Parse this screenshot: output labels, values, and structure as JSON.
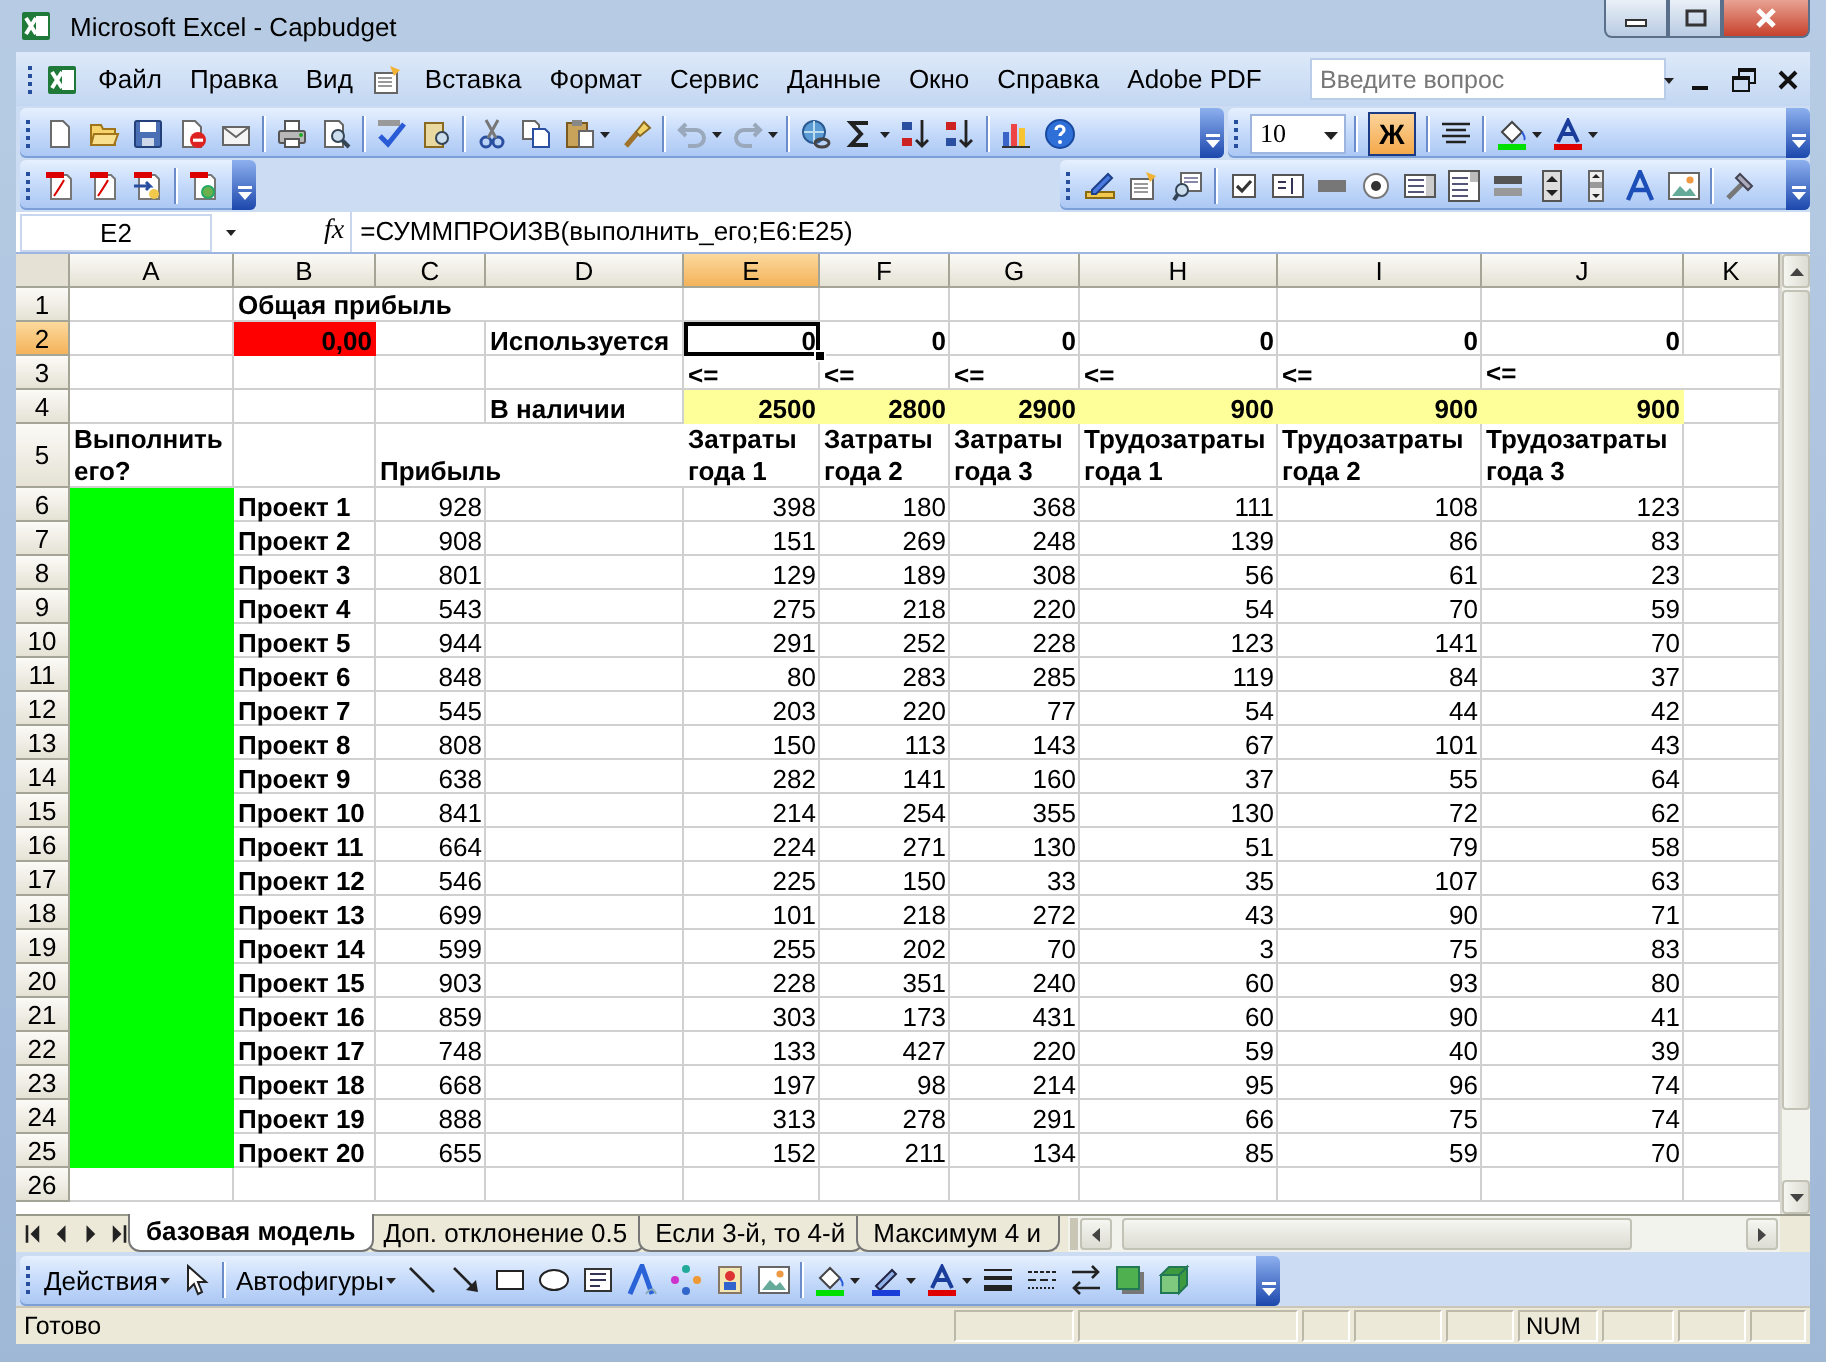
{
  "window": {
    "title": "Microsoft Excel - Capbudget"
  },
  "menu": [
    "Файл",
    "Правка",
    "Вид",
    "Вставка",
    "Формат",
    "Сервис",
    "Данные",
    "Окно",
    "Справка",
    "Adobe PDF"
  ],
  "help_search": {
    "placeholder": "Введите вопрос"
  },
  "formatting": {
    "font_size": "10",
    "bold": {
      "label": "Ж",
      "on": true
    }
  },
  "formula_bar": {
    "name_box": "E2",
    "function_label": "fx",
    "formula": "=СУММПРОИЗВ(выполнить_его;E6:E25)"
  },
  "grid": {
    "columns": [
      {
        "label": "A",
        "selected": false
      },
      {
        "label": "B",
        "selected": false
      },
      {
        "label": "C",
        "selected": false
      },
      {
        "label": "D",
        "selected": false
      },
      {
        "label": "E",
        "selected": true
      },
      {
        "label": "F",
        "selected": false
      },
      {
        "label": "G",
        "selected": false
      },
      {
        "label": "H",
        "selected": false
      },
      {
        "label": "I",
        "selected": false
      },
      {
        "label": "J",
        "selected": false
      },
      {
        "label": "K",
        "selected": false
      }
    ],
    "rows": [
      {
        "number": "1",
        "selected": false,
        "cells": [
          null,
          {
            "text": "Общая прибыль",
            "kind": "text"
          }
        ]
      },
      {
        "number": "2",
        "selected": true,
        "cells": [
          null,
          {
            "text": "0,00",
            "kind": "number",
            "color": "#ff0000"
          },
          null,
          {
            "text": "Используется",
            "kind": "text"
          },
          {
            "text": "0",
            "kind": "number",
            "selected": true
          },
          {
            "text": "0",
            "kind": "number"
          },
          {
            "text": "0",
            "kind": "number"
          },
          {
            "text": "0",
            "kind": "number"
          },
          {
            "text": "0",
            "kind": "number"
          },
          {
            "text": "0",
            "kind": "number"
          }
        ]
      },
      {
        "number": "3",
        "selected": false,
        "cells": [
          null,
          null,
          null,
          null,
          {
            "text": "<=",
            "kind": "text"
          },
          {
            "text": "<=",
            "kind": "text"
          },
          {
            "text": "<=",
            "kind": "text"
          },
          {
            "text": "<=",
            "kind": "text"
          },
          {
            "text": "<=",
            "kind": "text"
          },
          {
            "text": "<=",
            "kind": "text"
          }
        ]
      },
      {
        "number": "4",
        "selected": false,
        "cells": [
          null,
          null,
          null,
          {
            "text": "В наличии",
            "kind": "text"
          },
          {
            "text": "2500",
            "kind": "number",
            "color": "#ffff99"
          },
          {
            "text": "2800",
            "kind": "number",
            "color": "#ffff99"
          },
          {
            "text": "2900",
            "kind": "number",
            "color": "#ffff99"
          },
          {
            "text": "900",
            "kind": "number",
            "color": "#ffff99"
          },
          {
            "text": "900",
            "kind": "number",
            "color": "#ffff99"
          },
          {
            "text": "900",
            "kind": "number",
            "color": "#ffff99"
          }
        ]
      },
      {
        "number": "5",
        "selected": false,
        "cells": [
          {
            "text": "Выполнить его?",
            "kind": "wrapped"
          },
          null,
          {
            "text": "Прибыль",
            "kind": "text"
          },
          null,
          {
            "text": "Затраты года 1",
            "kind": "wrapped"
          },
          {
            "text": "Затраты года 2",
            "kind": "wrapped"
          },
          {
            "text": "Затраты года 3",
            "kind": "wrapped"
          },
          {
            "text": "Трудозатраты года 1",
            "kind": "wrapped"
          },
          {
            "text": "Трудозатраты года 2",
            "kind": "wrapped"
          },
          {
            "text": "Трудозатраты года 3",
            "kind": "wrapped"
          }
        ]
      },
      {
        "number": "6",
        "selected": false,
        "cells": [
          {
            "color": "#00ff00"
          },
          {
            "text": "Проект 1",
            "kind": "text"
          },
          {
            "text": "928",
            "kind": "number"
          },
          null,
          {
            "text": "398",
            "kind": "number"
          },
          {
            "text": "180",
            "kind": "number"
          },
          {
            "text": "368",
            "kind": "number"
          },
          {
            "text": "111",
            "kind": "number"
          },
          {
            "text": "108",
            "kind": "number"
          },
          {
            "text": "123",
            "kind": "number"
          }
        ]
      },
      {
        "number": "7",
        "selected": false,
        "cells": [
          {
            "color": "#00ff00"
          },
          {
            "text": "Проект 2",
            "kind": "text"
          },
          {
            "text": "908",
            "kind": "number"
          },
          null,
          {
            "text": "151",
            "kind": "number"
          },
          {
            "text": "269",
            "kind": "number"
          },
          {
            "text": "248",
            "kind": "number"
          },
          {
            "text": "139",
            "kind": "number"
          },
          {
            "text": "86",
            "kind": "number"
          },
          {
            "text": "83",
            "kind": "number"
          }
        ]
      },
      {
        "number": "8",
        "selected": false,
        "cells": [
          {
            "color": "#00ff00"
          },
          {
            "text": "Проект 3",
            "kind": "text"
          },
          {
            "text": "801",
            "kind": "number"
          },
          null,
          {
            "text": "129",
            "kind": "number"
          },
          {
            "text": "189",
            "kind": "number"
          },
          {
            "text": "308",
            "kind": "number"
          },
          {
            "text": "56",
            "kind": "number"
          },
          {
            "text": "61",
            "kind": "number"
          },
          {
            "text": "23",
            "kind": "number"
          }
        ]
      },
      {
        "number": "9",
        "selected": false,
        "cells": [
          {
            "color": "#00ff00"
          },
          {
            "text": "Проект 4",
            "kind": "text"
          },
          {
            "text": "543",
            "kind": "number"
          },
          null,
          {
            "text": "275",
            "kind": "number"
          },
          {
            "text": "218",
            "kind": "number"
          },
          {
            "text": "220",
            "kind": "number"
          },
          {
            "text": "54",
            "kind": "number"
          },
          {
            "text": "70",
            "kind": "number"
          },
          {
            "text": "59",
            "kind": "number"
          }
        ]
      },
      {
        "number": "10",
        "selected": false,
        "cells": [
          {
            "color": "#00ff00"
          },
          {
            "text": "Проект 5",
            "kind": "text"
          },
          {
            "text": "944",
            "kind": "number"
          },
          null,
          {
            "text": "291",
            "kind": "number"
          },
          {
            "text": "252",
            "kind": "number"
          },
          {
            "text": "228",
            "kind": "number"
          },
          {
            "text": "123",
            "kind": "number"
          },
          {
            "text": "141",
            "kind": "number"
          },
          {
            "text": "70",
            "kind": "number"
          }
        ]
      },
      {
        "number": "11",
        "selected": false,
        "cells": [
          {
            "color": "#00ff00"
          },
          {
            "text": "Проект 6",
            "kind": "text"
          },
          {
            "text": "848",
            "kind": "number"
          },
          null,
          {
            "text": "80",
            "kind": "number"
          },
          {
            "text": "283",
            "kind": "number"
          },
          {
            "text": "285",
            "kind": "number"
          },
          {
            "text": "119",
            "kind": "number"
          },
          {
            "text": "84",
            "kind": "number"
          },
          {
            "text": "37",
            "kind": "number"
          }
        ]
      },
      {
        "number": "12",
        "selected": false,
        "cells": [
          {
            "color": "#00ff00"
          },
          {
            "text": "Проект 7",
            "kind": "text"
          },
          {
            "text": "545",
            "kind": "number"
          },
          null,
          {
            "text": "203",
            "kind": "number"
          },
          {
            "text": "220",
            "kind": "number"
          },
          {
            "text": "77",
            "kind": "number"
          },
          {
            "text": "54",
            "kind": "number"
          },
          {
            "text": "44",
            "kind": "number"
          },
          {
            "text": "42",
            "kind": "number"
          }
        ]
      },
      {
        "number": "13",
        "selected": false,
        "cells": [
          {
            "color": "#00ff00"
          },
          {
            "text": "Проект 8",
            "kind": "text"
          },
          {
            "text": "808",
            "kind": "number"
          },
          null,
          {
            "text": "150",
            "kind": "number"
          },
          {
            "text": "113",
            "kind": "number"
          },
          {
            "text": "143",
            "kind": "number"
          },
          {
            "text": "67",
            "kind": "number"
          },
          {
            "text": "101",
            "kind": "number"
          },
          {
            "text": "43",
            "kind": "number"
          }
        ]
      },
      {
        "number": "14",
        "selected": false,
        "cells": [
          {
            "color": "#00ff00"
          },
          {
            "text": "Проект 9",
            "kind": "text"
          },
          {
            "text": "638",
            "kind": "number"
          },
          null,
          {
            "text": "282",
            "kind": "number"
          },
          {
            "text": "141",
            "kind": "number"
          },
          {
            "text": "160",
            "kind": "number"
          },
          {
            "text": "37",
            "kind": "number"
          },
          {
            "text": "55",
            "kind": "number"
          },
          {
            "text": "64",
            "kind": "number"
          }
        ]
      },
      {
        "number": "15",
        "selected": false,
        "cells": [
          {
            "color": "#00ff00"
          },
          {
            "text": "Проект 10",
            "kind": "text"
          },
          {
            "text": "841",
            "kind": "number"
          },
          null,
          {
            "text": "214",
            "kind": "number"
          },
          {
            "text": "254",
            "kind": "number"
          },
          {
            "text": "355",
            "kind": "number"
          },
          {
            "text": "130",
            "kind": "number"
          },
          {
            "text": "72",
            "kind": "number"
          },
          {
            "text": "62",
            "kind": "number"
          }
        ]
      },
      {
        "number": "16",
        "selected": false,
        "cells": [
          {
            "color": "#00ff00"
          },
          {
            "text": "Проект 11",
            "kind": "text"
          },
          {
            "text": "664",
            "kind": "number"
          },
          null,
          {
            "text": "224",
            "kind": "number"
          },
          {
            "text": "271",
            "kind": "number"
          },
          {
            "text": "130",
            "kind": "number"
          },
          {
            "text": "51",
            "kind": "number"
          },
          {
            "text": "79",
            "kind": "number"
          },
          {
            "text": "58",
            "kind": "number"
          }
        ]
      },
      {
        "number": "17",
        "selected": false,
        "cells": [
          {
            "color": "#00ff00"
          },
          {
            "text": "Проект 12",
            "kind": "text"
          },
          {
            "text": "546",
            "kind": "number"
          },
          null,
          {
            "text": "225",
            "kind": "number"
          },
          {
            "text": "150",
            "kind": "number"
          },
          {
            "text": "33",
            "kind": "number"
          },
          {
            "text": "35",
            "kind": "number"
          },
          {
            "text": "107",
            "kind": "number"
          },
          {
            "text": "63",
            "kind": "number"
          }
        ]
      },
      {
        "number": "18",
        "selected": false,
        "cells": [
          {
            "color": "#00ff00"
          },
          {
            "text": "Проект 13",
            "kind": "text"
          },
          {
            "text": "699",
            "kind": "number"
          },
          null,
          {
            "text": "101",
            "kind": "number"
          },
          {
            "text": "218",
            "kind": "number"
          },
          {
            "text": "272",
            "kind": "number"
          },
          {
            "text": "43",
            "kind": "number"
          },
          {
            "text": "90",
            "kind": "number"
          },
          {
            "text": "71",
            "kind": "number"
          }
        ]
      },
      {
        "number": "19",
        "selected": false,
        "cells": [
          {
            "color": "#00ff00"
          },
          {
            "text": "Проект 14",
            "kind": "text"
          },
          {
            "text": "599",
            "kind": "number"
          },
          null,
          {
            "text": "255",
            "kind": "number"
          },
          {
            "text": "202",
            "kind": "number"
          },
          {
            "text": "70",
            "kind": "number"
          },
          {
            "text": "3",
            "kind": "number"
          },
          {
            "text": "75",
            "kind": "number"
          },
          {
            "text": "83",
            "kind": "number"
          }
        ]
      },
      {
        "number": "20",
        "selected": false,
        "cells": [
          {
            "color": "#00ff00"
          },
          {
            "text": "Проект 15",
            "kind": "text"
          },
          {
            "text": "903",
            "kind": "number"
          },
          null,
          {
            "text": "228",
            "kind": "number"
          },
          {
            "text": "351",
            "kind": "number"
          },
          {
            "text": "240",
            "kind": "number"
          },
          {
            "text": "60",
            "kind": "number"
          },
          {
            "text": "93",
            "kind": "number"
          },
          {
            "text": "80",
            "kind": "number"
          }
        ]
      },
      {
        "number": "21",
        "selected": false,
        "cells": [
          {
            "color": "#00ff00"
          },
          {
            "text": "Проект 16",
            "kind": "text"
          },
          {
            "text": "859",
            "kind": "number"
          },
          null,
          {
            "text": "303",
            "kind": "number"
          },
          {
            "text": "173",
            "kind": "number"
          },
          {
            "text": "431",
            "kind": "number"
          },
          {
            "text": "60",
            "kind": "number"
          },
          {
            "text": "90",
            "kind": "number"
          },
          {
            "text": "41",
            "kind": "number"
          }
        ]
      },
      {
        "number": "22",
        "selected": false,
        "cells": [
          {
            "color": "#00ff00"
          },
          {
            "text": "Проект 17",
            "kind": "text"
          },
          {
            "text": "748",
            "kind": "number"
          },
          null,
          {
            "text": "133",
            "kind": "number"
          },
          {
            "text": "427",
            "kind": "number"
          },
          {
            "text": "220",
            "kind": "number"
          },
          {
            "text": "59",
            "kind": "number"
          },
          {
            "text": "40",
            "kind": "number"
          },
          {
            "text": "39",
            "kind": "number"
          }
        ]
      },
      {
        "number": "23",
        "selected": false,
        "cells": [
          {
            "color": "#00ff00"
          },
          {
            "text": "Проект 18",
            "kind": "text"
          },
          {
            "text": "668",
            "kind": "number"
          },
          null,
          {
            "text": "197",
            "kind": "number"
          },
          {
            "text": "98",
            "kind": "number"
          },
          {
            "text": "214",
            "kind": "number"
          },
          {
            "text": "95",
            "kind": "number"
          },
          {
            "text": "96",
            "kind": "number"
          },
          {
            "text": "74",
            "kind": "number"
          }
        ]
      },
      {
        "number": "24",
        "selected": false,
        "cells": [
          {
            "color": "#00ff00"
          },
          {
            "text": "Проект 19",
            "kind": "text"
          },
          {
            "text": "888",
            "kind": "number"
          },
          null,
          {
            "text": "313",
            "kind": "number"
          },
          {
            "text": "278",
            "kind": "number"
          },
          {
            "text": "291",
            "kind": "number"
          },
          {
            "text": "66",
            "kind": "number"
          },
          {
            "text": "75",
            "kind": "number"
          },
          {
            "text": "74",
            "kind": "number"
          }
        ]
      },
      {
        "number": "25",
        "selected": false,
        "cells": [
          {
            "color": "#00ff00"
          },
          {
            "text": "Проект 20",
            "kind": "text"
          },
          {
            "text": "655",
            "kind": "number"
          },
          null,
          {
            "text": "152",
            "kind": "number"
          },
          {
            "text": "211",
            "kind": "number"
          },
          {
            "text": "134",
            "kind": "number"
          },
          {
            "text": "85",
            "kind": "number"
          },
          {
            "text": "59",
            "kind": "number"
          },
          {
            "text": "70",
            "kind": "number"
          }
        ]
      },
      {
        "number": "26",
        "selected": false
      }
    ]
  },
  "sheet_tabs": [
    {
      "label": "базовая модель",
      "selected": true
    },
    {
      "label": "Доп. отклонение 0.5",
      "selected": false
    },
    {
      "label": "Если 3-й, то 4-й",
      "selected": false
    },
    {
      "label": "Максимум 4 и",
      "selected": false
    }
  ],
  "drawing_toolbar": {
    "actions": "Действия",
    "autoshapes": "Автофигуры"
  },
  "status_bar": {
    "status": "Готово",
    "indicators": [
      "NUM"
    ]
  }
}
